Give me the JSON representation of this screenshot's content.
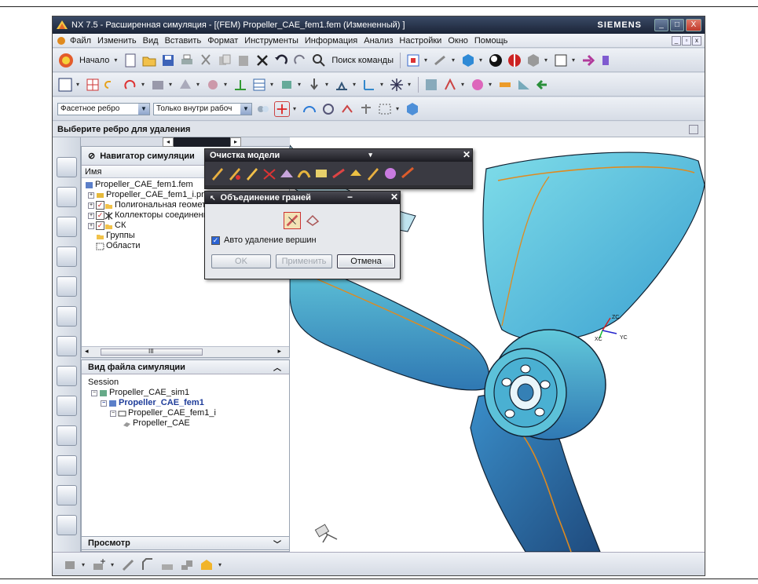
{
  "window": {
    "title": "NX 7.5 - Расширенная симуляция - [(FEM) Propeller_CAE_fem1.fem (Измененный) ]",
    "brand": "SIEMENS",
    "controls": [
      "_",
      "□",
      "X"
    ]
  },
  "menu": {
    "items": [
      "Файл",
      "Изменить",
      "Вид",
      "Вставить",
      "Формат",
      "Инструменты",
      "Информация",
      "Анализ",
      "Настройки",
      "Окно",
      "Помощь"
    ]
  },
  "toolbar1": {
    "start_label": "Начало",
    "command_search_label": "Поиск команды"
  },
  "filterbar": {
    "edge_filter_value": "Фасетное ребро",
    "scope_value": "Только внутри рабоч"
  },
  "cue": {
    "text": "Выберите ребро для удаления"
  },
  "navigator": {
    "title": "Навигатор симуляции",
    "column_name": "Имя",
    "items": [
      {
        "label": "Propeller_CAE_fem1.fem",
        "level": 0,
        "expander": ""
      },
      {
        "label": "Propeller_CAE_fem1_i.prt",
        "level": 1,
        "expander": "+"
      },
      {
        "label": "Полигональная геометр",
        "level": 1,
        "expander": "+"
      },
      {
        "label": "Коллекторы соединени",
        "level": 1,
        "expander": "+"
      },
      {
        "label": "СК",
        "level": 1,
        "expander": "+"
      },
      {
        "label": "Группы",
        "level": 1,
        "expander": ""
      },
      {
        "label": "Области",
        "level": 1,
        "expander": ""
      }
    ],
    "scroll_mark": "III"
  },
  "sim_file_view": {
    "title": "Вид файла симуляции",
    "items": [
      {
        "label": "Session",
        "level": 0,
        "bold": false
      },
      {
        "label": "Propeller_CAE_sim1",
        "level": 1,
        "bold": false
      },
      {
        "label": "Propeller_CAE_fem1",
        "level": 2,
        "bold": true
      },
      {
        "label": "Propeller_CAE_fem1_i",
        "level": 3,
        "bold": false
      },
      {
        "label": "Propeller_CAE",
        "level": 4,
        "bold": false
      }
    ]
  },
  "preview": {
    "title": "Просмотр"
  },
  "dialog_cleanup": {
    "title": "Очистка модели"
  },
  "dialog_merge": {
    "title": "Объединение граней",
    "checkbox_label": "Авто удаление вершин",
    "ok_label": "OK",
    "apply_label": "Применить",
    "cancel_label": "Отмена"
  },
  "triad": {
    "zc": "ZC",
    "xc": "XC",
    "yc": "YC"
  },
  "colors": {
    "propeller_light": "#4fc6dd",
    "propeller_dark": "#2b5f97",
    "edge_highlight": "#e08a1e"
  }
}
